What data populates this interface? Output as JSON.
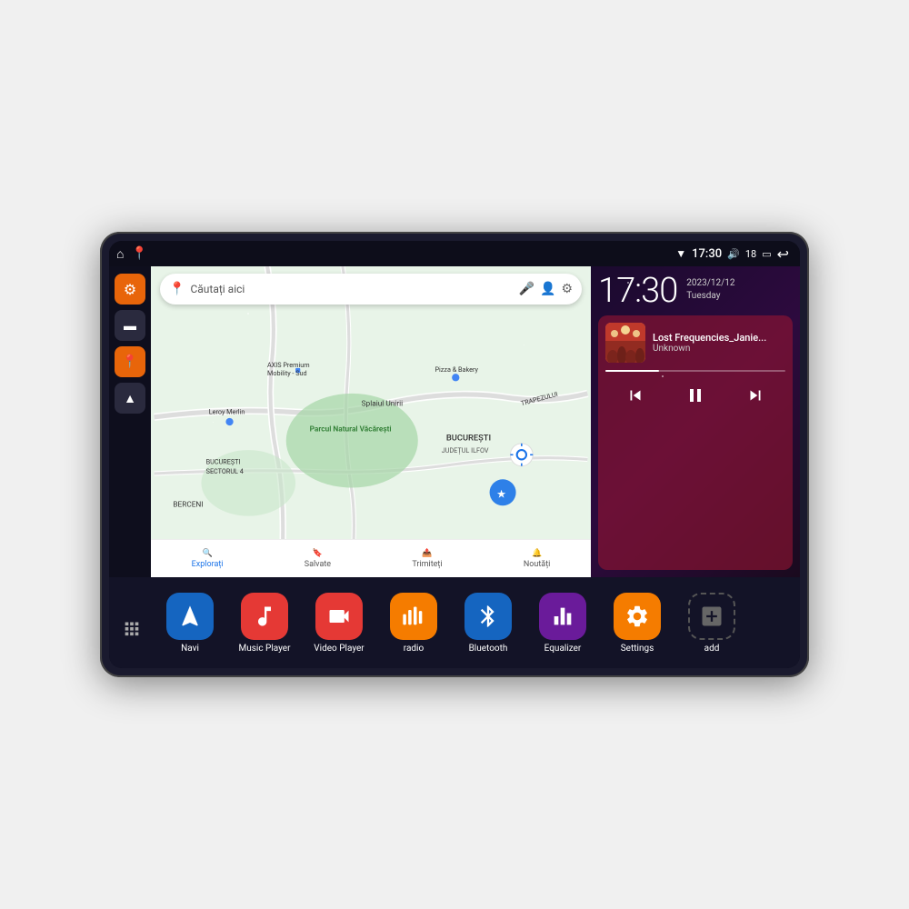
{
  "device": {
    "status_bar": {
      "wifi_icon": "▼",
      "time": "17:30",
      "volume_icon": "🔊",
      "battery_level": "18",
      "battery_icon": "🔋",
      "back_icon": "↩"
    },
    "sidebar": {
      "items": [
        {
          "name": "settings",
          "icon": "⚙",
          "color": "orange"
        },
        {
          "name": "files",
          "icon": "▬",
          "color": "dark"
        },
        {
          "name": "maps",
          "icon": "📍",
          "color": "orange"
        },
        {
          "name": "navigation",
          "icon": "▲",
          "color": "dark"
        }
      ]
    },
    "map": {
      "search_placeholder": "Căutați aici",
      "bottom_items": [
        {
          "label": "Explorați",
          "icon": "🔍"
        },
        {
          "label": "Salvate",
          "icon": "🔖"
        },
        {
          "label": "Trimiteți",
          "icon": "📤"
        },
        {
          "label": "Noutăți",
          "icon": "🔔"
        }
      ]
    },
    "clock": {
      "time": "17:30",
      "date": "2023/12/12",
      "day": "Tuesday"
    },
    "music": {
      "title": "Lost Frequencies_Janie...",
      "artist": "Unknown",
      "progress": 30
    },
    "apps": [
      {
        "name": "Navi",
        "icon": "▲",
        "color_class": "app-navi"
      },
      {
        "name": "Music Player",
        "icon": "🎵",
        "color_class": "app-music"
      },
      {
        "name": "Video Player",
        "icon": "▶",
        "color_class": "app-video"
      },
      {
        "name": "radio",
        "icon": "📻",
        "color_class": "app-radio"
      },
      {
        "name": "Bluetooth",
        "icon": "⚡",
        "color_class": "app-bt"
      },
      {
        "name": "Equalizer",
        "icon": "🎛",
        "color_class": "app-eq"
      },
      {
        "name": "Settings",
        "icon": "⚙",
        "color_class": "app-settings"
      },
      {
        "name": "add",
        "icon": "+",
        "color_class": "app-add"
      }
    ]
  }
}
